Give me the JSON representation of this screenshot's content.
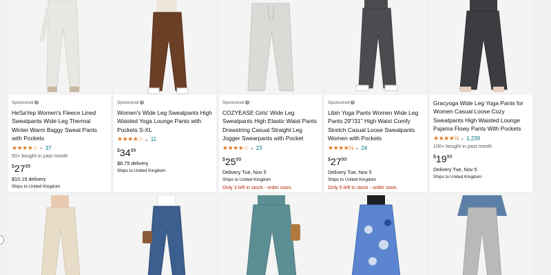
{
  "products": [
    {
      "sponsored": "Sponsored",
      "title": "HeSaYep Women's Fleece Lined Sweatpants Wide Leg Thermal Winter Warm Baggy Sweat Pants with Pockets",
      "stars": "★★★★☆",
      "rating_count": "37",
      "bought": "50+ bought in past month",
      "price_symbol": "$",
      "price_whole": "27",
      "price_fraction": "99",
      "delivery": "$10.19 delivery",
      "ships": "Ships to United Kingdom",
      "stock": "",
      "pants_color": "#e9e7e2"
    },
    {
      "sponsored": "Sponsored",
      "title": "Women's Wide Leg Sweatpants High Waisted Yoga Lounge Pants with Pockets S-XL",
      "stars": "★★★★☆",
      "rating_count": "11",
      "bought": "",
      "price_symbol": "$",
      "price_whole": "34",
      "price_fraction": "99",
      "delivery": "$8.75 delivery",
      "ships": "Ships to United Kingdom",
      "stock": "",
      "pants_color": "#6b3e26"
    },
    {
      "sponsored": "Sponsored",
      "title": "COZYEASE Girls' Wide Leg Sweatpants High Elastic Waist Pants Drawstring Casual Straight Leg Jogger Swearpants with Pocket",
      "stars": "★★★★☆",
      "rating_count": "23",
      "bought": "",
      "price_symbol": "$",
      "price_whole": "25",
      "price_fraction": "99",
      "delivery": "Delivery Tue, Nov 5",
      "ships": "Ships to United Kingdom",
      "stock": "Only 3 left in stock - order soon.",
      "pants_color": "#dcdad6"
    },
    {
      "sponsored": "Sponsored",
      "title": "Libin Yoga Pants Women Wide Leg Pants 29\"/31\" High Waist Comfy Stretch Casual Loose Sweatpants Women with Pockets",
      "stars": "★★★★½",
      "rating_count": "24",
      "bought": "",
      "price_symbol": "$",
      "price_whole": "27",
      "price_fraction": "99",
      "delivery": "Delivery Tue, Nov 5",
      "ships": "Ships to United Kingdom",
      "stock": "Only 5 left in stock - order soon.",
      "pants_color": "#4a4c4f"
    },
    {
      "sponsored": "",
      "title": "Gracyoga Wide Leg Yoga Pants for Women Casual Loose Cozy Sweatpants High Waisted Lounge Pajama Flowy Pants With Pockets",
      "stars": "★★★★½",
      "rating_count": "1,239",
      "bought": "100+ bought in past month",
      "price_symbol": "$",
      "price_whole": "19",
      "price_fraction": "99",
      "delivery": "Delivery Tue, Nov 5",
      "ships": "Ships to United Kingdom",
      "stock": "",
      "pants_color": "#3b3d40"
    }
  ],
  "row2": [
    {
      "pants_color": "#e7dcc8"
    },
    {
      "pants_color": "#3d5f8f"
    },
    {
      "pants_color": "#5b8f93"
    },
    {
      "pants_color": "#5b86cf"
    },
    {
      "pants_color": "#b9b9b9"
    }
  ],
  "colors": {
    "star": "#de7921",
    "link": "#007185",
    "stock": "#b12704",
    "background": "#f0f2f2"
  }
}
